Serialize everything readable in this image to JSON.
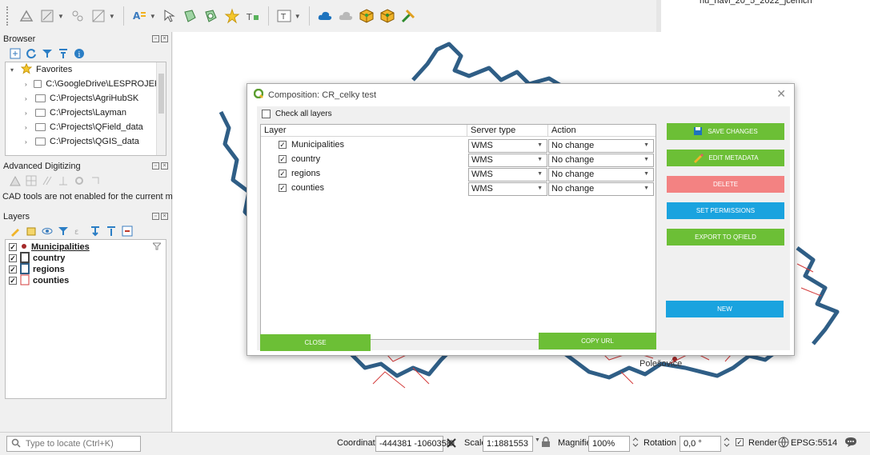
{
  "colors": {
    "green": "#6cbf36",
    "red": "#f38282",
    "blue": "#1aa3df",
    "map_border": "#2f5e86",
    "map_red": "#d33b3b"
  },
  "top_right": {
    "layer_text": "nu_navi_20_5_2022_jcemch"
  },
  "browser": {
    "title": "Browser",
    "favorites_label": "Favorites",
    "items": [
      "C:\\GoogleDrive\\LESPROJEKT",
      "C:\\Projects\\AgriHubSK",
      "C:\\Projects\\Layman",
      "C:\\Projects\\QField_data",
      "C:\\Projects\\QGIS_data"
    ]
  },
  "advanced_digitizing": {
    "title": "Advanced Digitizing",
    "message": "CAD tools are not enabled for the current map tool"
  },
  "layers_panel": {
    "title": "Layers",
    "items": [
      {
        "label": "Municipalities",
        "symbol": "point"
      },
      {
        "label": "country",
        "symbol": "line"
      },
      {
        "label": "regions",
        "symbol": "polygon-blue"
      },
      {
        "label": "counties",
        "symbol": "polygon-red"
      }
    ]
  },
  "dialog": {
    "title": "Composition: CR_celky test",
    "check_all_label": "Check all layers",
    "columns": [
      "Layer",
      "Server type",
      "Action"
    ],
    "rows": [
      {
        "layer": "Municipalities",
        "server_type": "WMS",
        "action": "No change"
      },
      {
        "layer": "country",
        "server_type": "WMS",
        "action": "No change"
      },
      {
        "layer": "regions",
        "server_type": "WMS",
        "action": "No change"
      },
      {
        "layer": "counties",
        "server_type": "WMS",
        "action": "No change"
      }
    ],
    "buttons": {
      "save": "SAVE CHANGES",
      "edit": "EDIT METADATA",
      "delete": "DELETE",
      "permissions": "SET PERMISSIONS",
      "export": "EXPORT TO QFIELD",
      "new": "NEW",
      "close": "CLOSE",
      "copy_url": "COPY URL"
    }
  },
  "map": {
    "label": "Polešovice"
  },
  "status": {
    "locator_placeholder": "Type to locate (Ctrl+K)",
    "coordinate_label": "Coordinate",
    "coordinate_value": "-444381 -1060358",
    "scale_label": "Scale",
    "scale_value": "1:1881553",
    "magnifier_label": "Magnifier",
    "magnifier_value": "100%",
    "rotation_label": "Rotation",
    "rotation_value": "0,0 °",
    "render_label": "Render",
    "crs": "EPSG:5514"
  }
}
